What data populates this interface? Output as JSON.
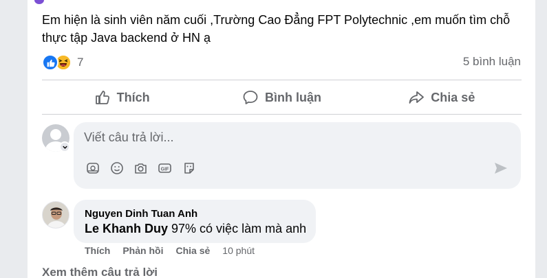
{
  "post": {
    "text": "Em hiện là sinh viên năm cuối ,Trường Cao Đẳng FPT Polytechnic ,em muốn tìm chỗ thực tập Java backend ở HN ạ",
    "reaction_count": "7",
    "comment_count": "5 bình luận"
  },
  "actions": {
    "like": "Thích",
    "comment": "Bình luận",
    "share": "Chia sẻ"
  },
  "composer": {
    "placeholder": "Viết câu trả lời..."
  },
  "reply": {
    "author": "Nguyen Dinh Tuan Anh",
    "mention": "Le Khanh Duy",
    "text": " 97% có việc làm mà anh",
    "like": "Thích",
    "reply": "Phản hồi",
    "share": "Chia sẻ",
    "time": "10 phút"
  },
  "more_replies": "Xem thêm câu trả lời",
  "colors": {
    "accent": "#1877f2",
    "muted_text": "#65676b",
    "bubble": "#f0f2f5"
  },
  "icons": [
    "like-reaction-icon",
    "haha-reaction-icon",
    "thumbs-up-icon",
    "comment-icon",
    "share-icon",
    "sticker-icon",
    "emoji-icon",
    "camera-icon",
    "gif-icon",
    "avatar-sticker-icon",
    "send-icon",
    "chevron-down-icon"
  ]
}
